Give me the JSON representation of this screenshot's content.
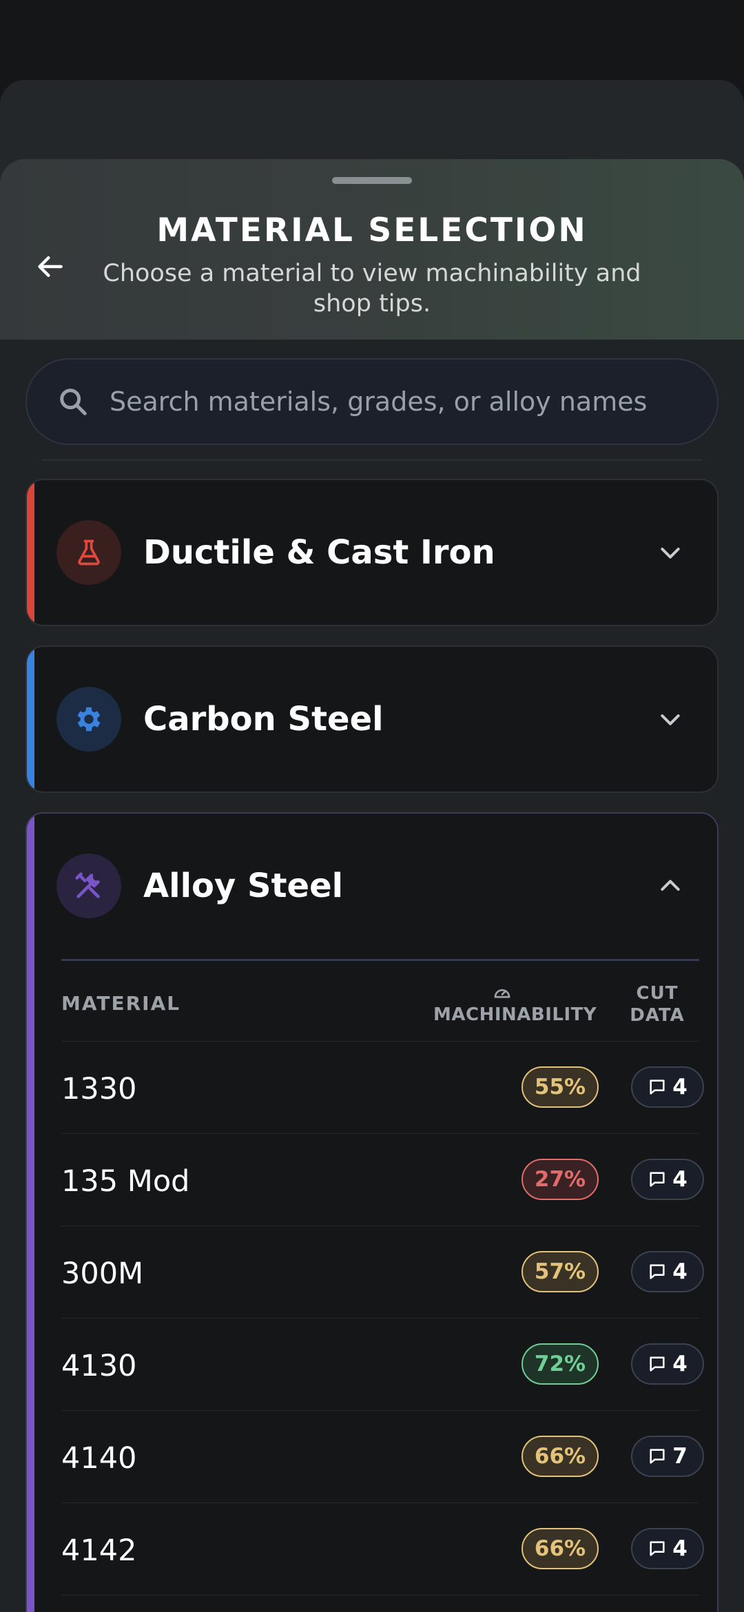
{
  "header": {
    "title": "MATERIAL SELECTION",
    "subtitle": "Choose a material to view machinability and shop tips."
  },
  "search": {
    "placeholder": "Search materials, grades, or alloy names"
  },
  "categories": [
    {
      "title": "Ductile & Cast Iron",
      "icon": "flask-icon",
      "accent": "#d9453a",
      "expanded": false
    },
    {
      "title": "Carbon Steel",
      "icon": "gear-icon",
      "accent": "#3a82e0",
      "expanded": false
    },
    {
      "title": "Alloy Steel",
      "icon": "tools-icon",
      "accent": "#7a55c8",
      "expanded": true
    }
  ],
  "table": {
    "col_material": "MATERIAL",
    "col_machinability": "MACHINABILITY",
    "col_cut_data": "CUT DATA",
    "rows": [
      {
        "name": "1330",
        "machinability": "55%",
        "level": "medium",
        "cut_data": "4"
      },
      {
        "name": "135 Mod",
        "machinability": "27%",
        "level": "low",
        "cut_data": "4"
      },
      {
        "name": "300M",
        "machinability": "57%",
        "level": "medium",
        "cut_data": "4"
      },
      {
        "name": "4130",
        "machinability": "72%",
        "level": "high",
        "cut_data": "4"
      },
      {
        "name": "4140",
        "machinability": "66%",
        "level": "medium",
        "cut_data": "7"
      },
      {
        "name": "4142",
        "machinability": "66%",
        "level": "medium",
        "cut_data": "4"
      }
    ]
  },
  "colors": {
    "low": "#e06c6c",
    "medium": "#e3c27a",
    "high": "#6fcf97"
  }
}
